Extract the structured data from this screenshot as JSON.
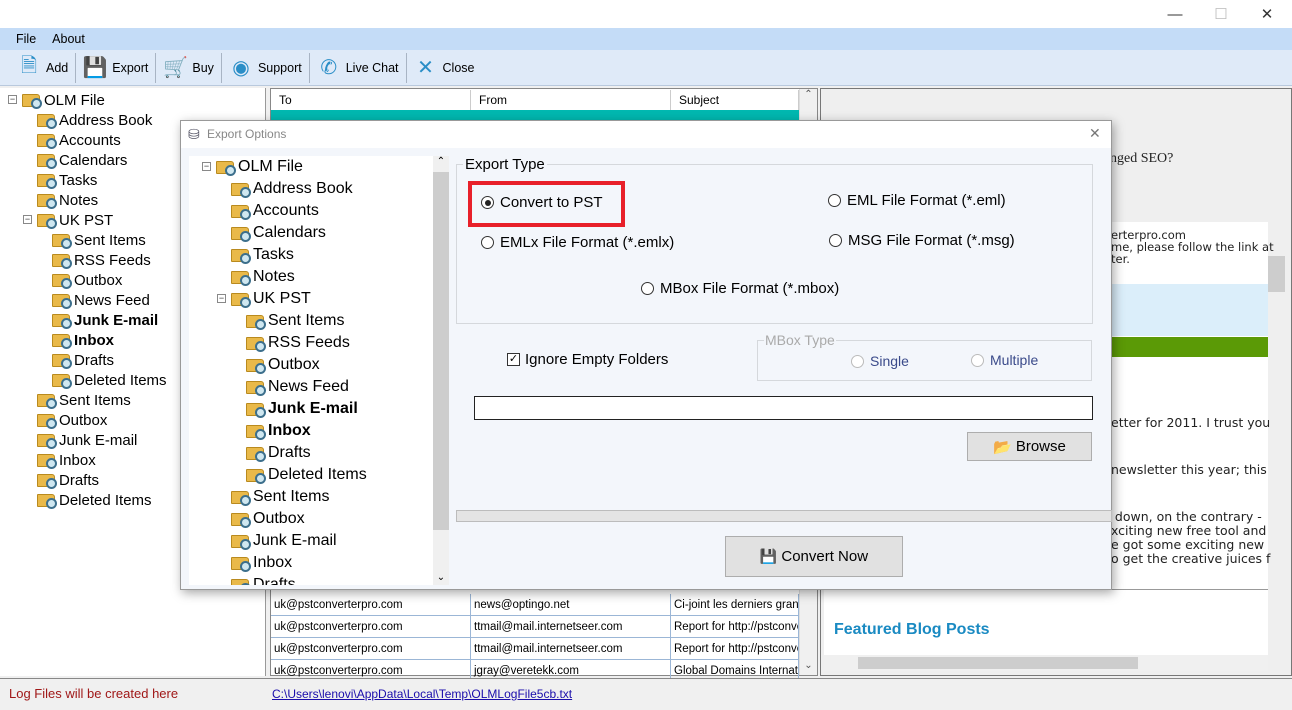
{
  "window": {
    "controls": {
      "minimize": "—",
      "maximize": "☐",
      "close": "✕"
    }
  },
  "menu": [
    "File",
    "About"
  ],
  "toolbar": [
    {
      "label": "Add",
      "icon": "add-file-icon"
    },
    {
      "label": "Export",
      "icon": "save-disk-icon"
    },
    {
      "label": "Buy",
      "icon": "cart-icon"
    },
    {
      "label": "Support",
      "icon": "support-user-icon"
    },
    {
      "label": "Live Chat",
      "icon": "phone-icon"
    },
    {
      "label": "Close",
      "icon": "close-x-icon"
    }
  ],
  "tree": [
    {
      "label": "OLM File",
      "level": 0,
      "expander": "−"
    },
    {
      "label": "Address Book",
      "level": 1
    },
    {
      "label": "Accounts",
      "level": 1
    },
    {
      "label": "Calendars",
      "level": 1
    },
    {
      "label": "Tasks",
      "level": 1
    },
    {
      "label": "Notes",
      "level": 1
    },
    {
      "label": "UK PST",
      "level": 1,
      "expander": "−"
    },
    {
      "label": "Sent Items",
      "level": 2
    },
    {
      "label": "RSS Feeds",
      "level": 2
    },
    {
      "label": "Outbox",
      "level": 2
    },
    {
      "label": "News Feed",
      "level": 2
    },
    {
      "label": "Junk E-mail",
      "level": 2,
      "bold": true
    },
    {
      "label": "Inbox",
      "level": 2,
      "bold": true
    },
    {
      "label": "Drafts",
      "level": 2
    },
    {
      "label": "Deleted Items",
      "level": 2
    },
    {
      "label": "Sent Items",
      "level": 1
    },
    {
      "label": "Outbox",
      "level": 1
    },
    {
      "label": "Junk E-mail",
      "level": 1
    },
    {
      "label": "Inbox",
      "level": 1
    },
    {
      "label": "Drafts",
      "level": 1
    },
    {
      "label": "Deleted Items",
      "level": 1
    }
  ],
  "email_list": {
    "columns": [
      "To",
      "From",
      "Subject"
    ],
    "selected_color": "#00b8b0",
    "rows": [
      [
        "uk@pstconverterpro.com",
        "news@optingo.net",
        "Ci-joint les derniers grands"
      ],
      [
        "uk@pstconverterpro.com",
        "ttmail@mail.internetseer.com",
        "Report for http://pstconve"
      ],
      [
        "uk@pstconverterpro.com",
        "ttmail@mail.internetseer.com",
        "Report for http://pstconve"
      ],
      [
        "uk@pstconverterpro.com",
        "jgray@veretekk.com",
        "Global Domains Internation"
      ]
    ]
  },
  "preview": {
    "subject_fragment": "nged SEO?",
    "lines_top": [
      "erterpro.com",
      "me, please follow the link at",
      "ter."
    ],
    "lines_body": [
      "etter for 2011. I trust you",
      "newsletter this year; this",
      "d down, on the contrary -",
      "xciting new free tool and",
      "e got some exciting new",
      "o get the creative juices f"
    ],
    "featured": "Featured Blog Posts"
  },
  "status": {
    "log_label": "Log Files will be created here",
    "log_path": "C:\\Users\\lenovi\\AppData\\Local\\Temp\\OLMLogFile5cb.txt"
  },
  "dialog": {
    "title": "Export Options",
    "close": "✕",
    "export_type_label": "Export Type",
    "options": {
      "pst": "Convert to PST",
      "eml": "EML File  Format (*.eml)",
      "emlx": "EMLx File  Format (*.emlx)",
      "msg": "MSG File Format (*.msg)",
      "mbox": "MBox File Format (*.mbox)"
    },
    "selected": "pst",
    "highlight_color": "#e8202a",
    "ignore_empty": {
      "label": "Ignore Empty Folders",
      "checked": true
    },
    "mbox_type": {
      "label": "MBox Type",
      "single": "Single",
      "multiple": "Multiple"
    },
    "path_value": "",
    "browse": "Browse",
    "progress": 0,
    "convert": "Convert Now"
  }
}
